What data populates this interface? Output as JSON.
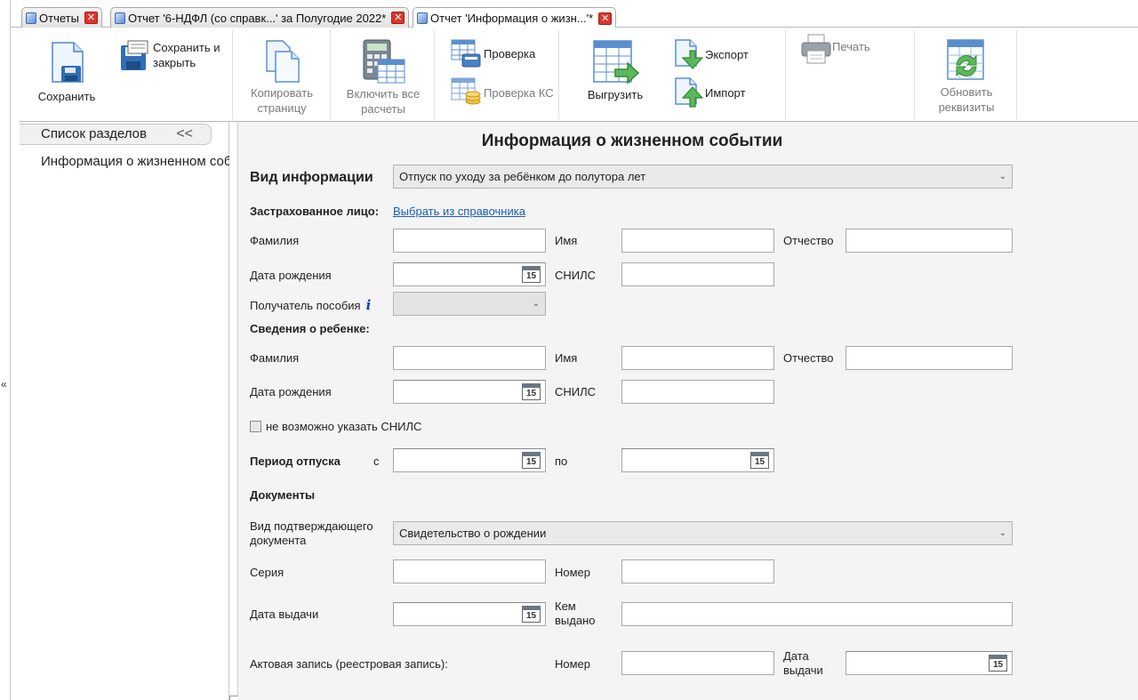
{
  "tabs": [
    {
      "label": "Отчеты",
      "active": false
    },
    {
      "label": "Отчет '6-НДФЛ (со справк...' за Полугодие 2022*",
      "active": false
    },
    {
      "label": "Отчет 'Информация о жизн...'*",
      "active": true
    }
  ],
  "ribbon": {
    "save": "Сохранить",
    "save_close_line1": "Сохранить и",
    "save_close_line2": "закрыть",
    "copy_line1": "Копировать",
    "copy_line2": "страницу",
    "include_line1": "Включить все",
    "include_line2": "расчеты",
    "check": "Проверка",
    "check_ks": "Проверка КС",
    "upload": "Выгрузить",
    "export": "Экспорт",
    "import": "Импорт",
    "print": "Печать",
    "refresh_line1": "Обновить",
    "refresh_line2": "реквизиты"
  },
  "sidebar": {
    "title": "Список разделов",
    "collapse": "<<",
    "items": [
      "Информация о жизненном событии"
    ]
  },
  "gutter_collapse": "«",
  "form": {
    "title": "Информация о жизненном событии",
    "info_type_label": "Вид информации",
    "info_type_value": "Отпуск по уходу за ребёнком до полутора лет",
    "insured_label": "Застрахованное лицо:",
    "pick_link": "Выбрать из справочника",
    "surname": "Фамилия",
    "name": "Имя",
    "patronymic": "Отчество",
    "birth_date": "Дата рождения",
    "snils": "СНИЛС",
    "recipient": "Получатель пособия",
    "child_label": "Сведения о ребенке:",
    "no_snils": "не возможно указать СНИЛС",
    "leave_period": "Период отпуска",
    "from": "с",
    "to": "по",
    "documents": "Документы",
    "doc_type_line1": "Вид подтверждающего",
    "doc_type_line2": "документа",
    "doc_type_value": "Свидетельство о рождении",
    "series": "Серия",
    "number": "Номер",
    "issue_date": "Дата выдачи",
    "issued_by_line1": "Кем",
    "issued_by_line2": "выдано",
    "act_record": "Актовая запись (реестровая запись):",
    "act_number": "Номер",
    "act_date_line1": "Дата",
    "act_date_line2": "выдачи",
    "cal_day": "15"
  }
}
